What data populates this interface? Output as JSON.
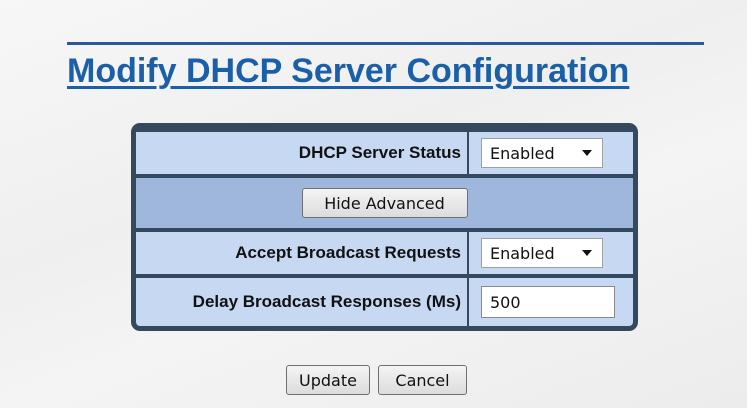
{
  "page": {
    "title": "Modify DHCP Server Configuration"
  },
  "form": {
    "dhcp_server_status": {
      "label": "DHCP Server Status",
      "value": "Enabled"
    },
    "hide_advanced_label": "Hide Advanced",
    "accept_broadcast_requests": {
      "label": "Accept Broadcast Requests",
      "value": "Enabled"
    },
    "delay_broadcast_responses": {
      "label": "Delay Broadcast Responses (Ms)",
      "value": "500"
    }
  },
  "actions": {
    "update_label": "Update",
    "cancel_label": "Cancel"
  },
  "colors": {
    "title": "#1a5fa8",
    "frame": "#34495e",
    "row_light": "#c6d8f2",
    "row_dark": "#9fb7dc"
  },
  "icons": {
    "dropdown": "chevron-down-icon"
  }
}
